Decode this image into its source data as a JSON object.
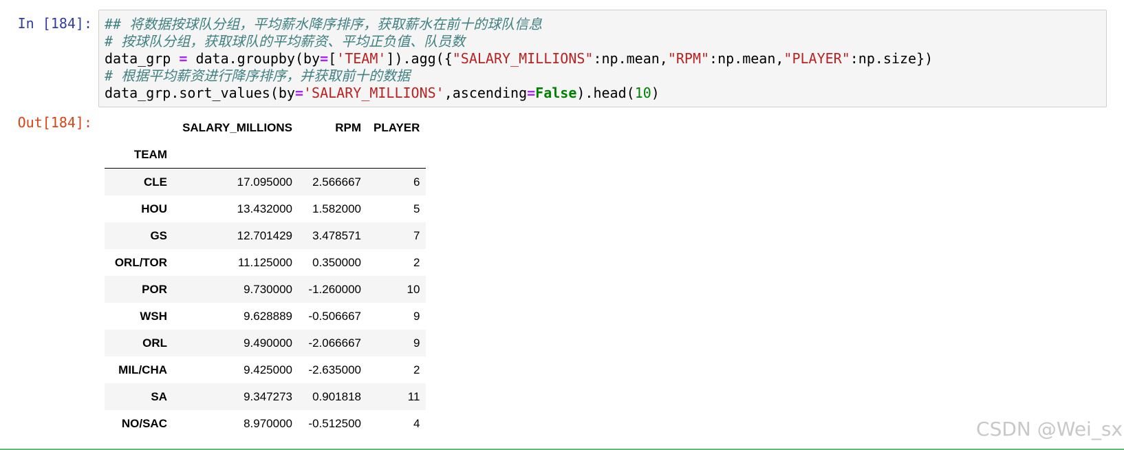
{
  "cell": {
    "in_prompt": "In [184]:",
    "out_prompt": "Out[184]:"
  },
  "code": {
    "line1_comment": "## 将数据按球队分组，平均薪水降序排序，获取薪水在前十的球队信息",
    "line2_comment": "# 按球队分组，获取球队的平均薪资、平均正负值、队员数",
    "line3": {
      "a": "data_grp ",
      "op1": "=",
      "b": " data.groupby(by",
      "op2": "=",
      "c": "[",
      "s1": "'TEAM'",
      "d": "]).agg({",
      "s2": "\"SALARY_MILLIONS\"",
      "e": ":np.mean,",
      "s3": "\"RPM\"",
      "f": ":np.mean,",
      "s4": "\"PLAYER\"",
      "g": ":np.size})"
    },
    "line4_comment": "# 根据平均薪资进行降序排序，并获取前十的数据",
    "line5": {
      "a": "data_grp.sort_values(by",
      "op1": "=",
      "s1": "'SALARY_MILLIONS'",
      "b": ",ascending",
      "op2": "=",
      "kw": "False",
      "c": ").head(",
      "num": "10",
      "d": ")"
    }
  },
  "table": {
    "columns": [
      "SALARY_MILLIONS",
      "RPM",
      "PLAYER"
    ],
    "index_name": "TEAM",
    "rows": [
      {
        "team": "CLE",
        "salary": "17.095000",
        "rpm": "2.566667",
        "player": "6"
      },
      {
        "team": "HOU",
        "salary": "13.432000",
        "rpm": "1.582000",
        "player": "5"
      },
      {
        "team": "GS",
        "salary": "12.701429",
        "rpm": "3.478571",
        "player": "7"
      },
      {
        "team": "ORL/TOR",
        "salary": "11.125000",
        "rpm": "0.350000",
        "player": "2"
      },
      {
        "team": "POR",
        "salary": "9.730000",
        "rpm": "-1.260000",
        "player": "10"
      },
      {
        "team": "WSH",
        "salary": "9.628889",
        "rpm": "-0.506667",
        "player": "9"
      },
      {
        "team": "ORL",
        "salary": "9.490000",
        "rpm": "-2.066667",
        "player": "9"
      },
      {
        "team": "MIL/CHA",
        "salary": "9.425000",
        "rpm": "-2.635000",
        "player": "2"
      },
      {
        "team": "SA",
        "salary": "9.347273",
        "rpm": "0.901818",
        "player": "11"
      },
      {
        "team": "NO/SAC",
        "salary": "8.970000",
        "rpm": "-0.512500",
        "player": "4"
      }
    ]
  },
  "watermark": "CSDN @Wei_sx",
  "colors": {
    "in_prompt": "#303f9f",
    "out_prompt": "#d84315",
    "comment": "#408080",
    "operator": "#aa22ff",
    "string": "#ba2121",
    "keyword": "#008000",
    "cell_bg": "#f5f5f5",
    "status_line": "#66bb6a"
  }
}
